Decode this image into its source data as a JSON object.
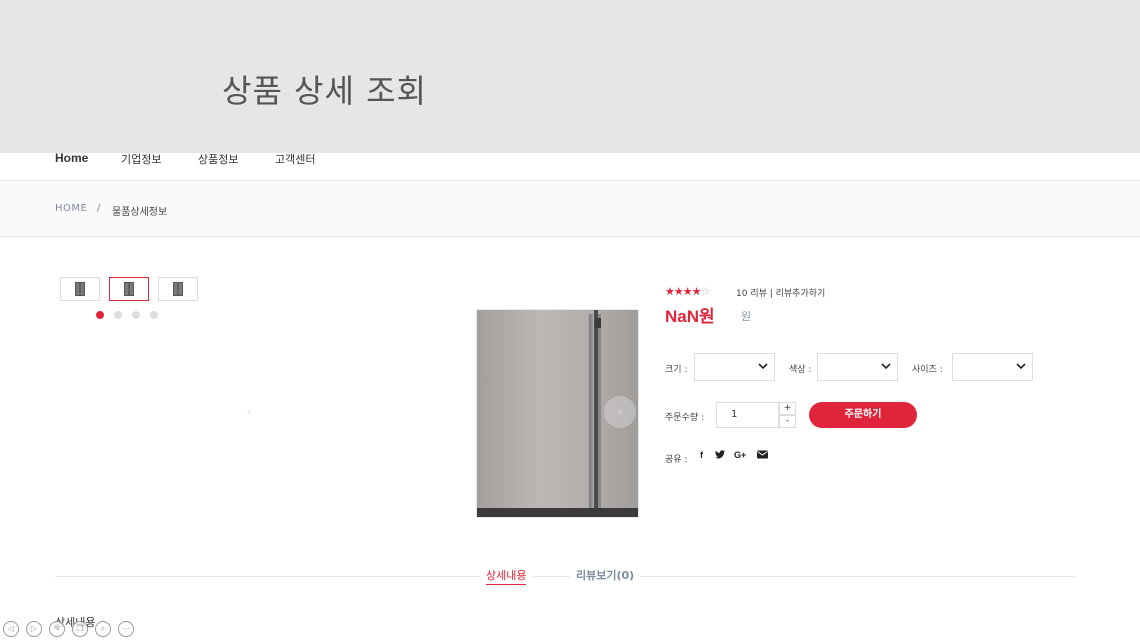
{
  "banner": {
    "title": "상품 상세 조회"
  },
  "nav": {
    "items": [
      "Home",
      "기업정보",
      "상품정보",
      "고객센터"
    ]
  },
  "breadcrumb": {
    "home": "HOME",
    "separator": "/",
    "current": "물품상세정보"
  },
  "gallery": {
    "thumbnail_count": 3,
    "active_thumbnail": 2,
    "dot_count": 4,
    "active_dot": 1,
    "prev_icon": "chevron-left-icon",
    "next_icon": "chevron-right-icon"
  },
  "product": {
    "rating": 4,
    "rating_max": 5,
    "review_text": "10 리뷰 | 리뷰추가하기",
    "price": "NaN원",
    "price_unit": "원"
  },
  "options": {
    "size_label": "크기 :",
    "color_label": "색상 :",
    "sizes_label": "사이즈 :"
  },
  "quantity": {
    "label": "주문수량 :",
    "value": "1",
    "plus": "+",
    "minus": "-"
  },
  "order_button": "주문하기",
  "share": {
    "label": "공유 :",
    "icons": [
      "facebook-icon",
      "twitter-icon",
      "google-plus-icon",
      "mail-icon"
    ],
    "facebook": "f",
    "google": "G+"
  },
  "tabs": {
    "detail": "상세내용",
    "reviews": "리뷰보기(0)"
  },
  "detail_heading": "상세내용",
  "colors": {
    "accent": "#e0253a",
    "banner_bg": "#e6e6e6",
    "muted_blue": "#7d8ba0"
  }
}
